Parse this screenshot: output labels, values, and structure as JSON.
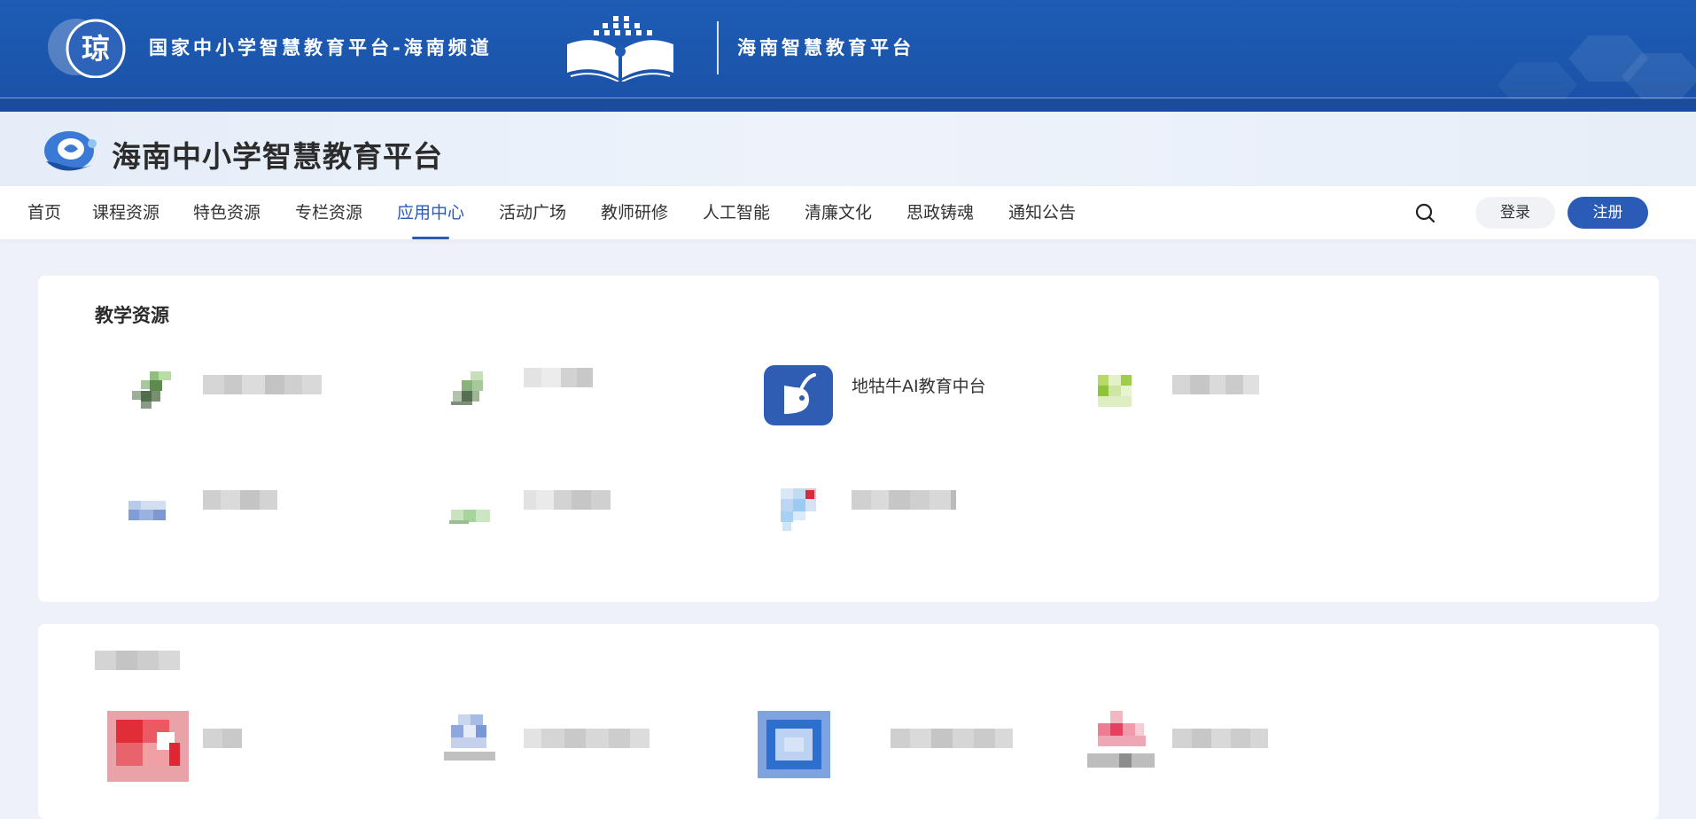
{
  "header": {
    "national_title": "国家中小学智慧教育平台-海南频道",
    "hainan_title": "海南智慧教育平台",
    "logo_char": "琼",
    "site_title": "海南中小学智慧教育平台"
  },
  "nav": {
    "items": [
      "首页",
      "课程资源",
      "特色资源",
      "专栏资源",
      "应用中心",
      "活动广场",
      "教师研修",
      "人工智能",
      "清廉文化",
      "思政铸魂",
      "通知公告"
    ],
    "active_index": 4,
    "search_icon": "search-icon",
    "login_label": "登录",
    "register_label": "注册"
  },
  "colors": {
    "brand_blue": "#2a5bb7",
    "banner_blue": "#1e5cb5",
    "app_icon_blue": "#2f5db4"
  },
  "sections": [
    {
      "title": "教学资源",
      "apps": [
        {
          "label": "",
          "icon": "blurred-green-icon"
        },
        {
          "label": "",
          "icon": "blurred-green-icon"
        },
        {
          "label": "地牯牛AI教育中台",
          "icon": "snail-app-icon"
        },
        {
          "label": "",
          "icon": "blurred-lime-icon"
        },
        {
          "label": "",
          "icon": "blurred-blue-icon"
        },
        {
          "label": "",
          "icon": "blurred-green-icon"
        },
        {
          "label": "",
          "icon": "blurred-lightblue-icon"
        }
      ]
    },
    {
      "title": "",
      "apps": [
        {
          "label": "",
          "icon": "blurred-red-icon"
        },
        {
          "label": "",
          "icon": "blurred-blue-icon"
        },
        {
          "label": "",
          "icon": "blurred-blue-square-icon"
        },
        {
          "label": "",
          "icon": "blurred-pink-icon"
        }
      ]
    }
  ]
}
